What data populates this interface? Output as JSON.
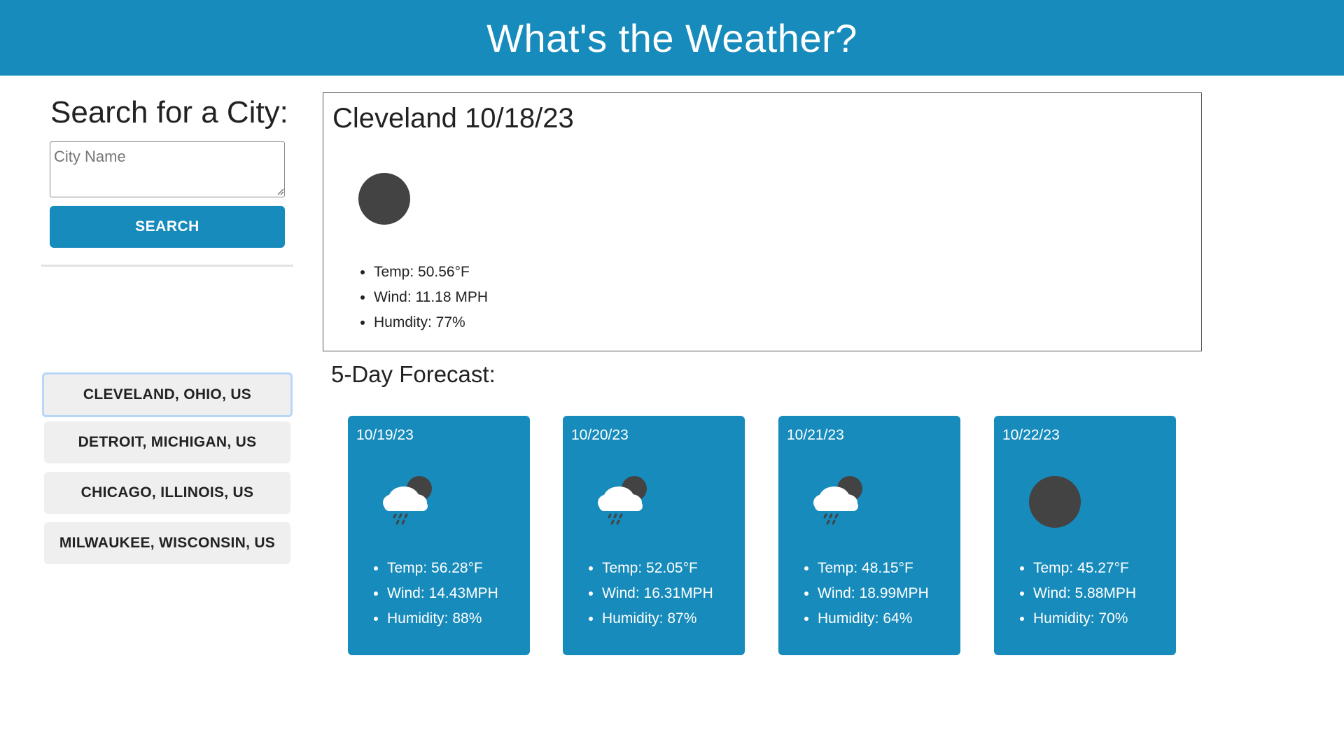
{
  "header": {
    "title": "What's the Weather?"
  },
  "sidebar": {
    "search_title": "Search for a City:",
    "input_placeholder": "City Name",
    "search_button": "SEARCH",
    "history": [
      {
        "label": "CLEVELAND, OHIO, US"
      },
      {
        "label": "DETROIT, MICHIGAN, US"
      },
      {
        "label": "CHICAGO, ILLINOIS, US"
      },
      {
        "label": "MILWAUKEE, WISCONSIN, US"
      }
    ]
  },
  "current": {
    "title": "Cleveland 10/18/23",
    "icon": "dark-circle-icon",
    "temp": "Temp: 50.56°F",
    "wind": "Wind: 11.18 MPH",
    "humidity": "Humdity: 77%"
  },
  "forecast": {
    "title": "5-Day Forecast:",
    "days": [
      {
        "date": "10/19/23",
        "icon": "rain-cloud-icon",
        "temp": "Temp: 56.28°F",
        "wind": "Wind: 14.43MPH",
        "humidity": "Humidity: 88%"
      },
      {
        "date": "10/20/23",
        "icon": "rain-cloud-icon",
        "temp": "Temp: 52.05°F",
        "wind": "Wind: 16.31MPH",
        "humidity": "Humidity: 87%"
      },
      {
        "date": "10/21/23",
        "icon": "rain-cloud-icon",
        "temp": "Temp: 48.15°F",
        "wind": "Wind: 18.99MPH",
        "humidity": "Humidity: 64%"
      },
      {
        "date": "10/22/23",
        "icon": "dark-circle-icon",
        "temp": "Temp: 45.27°F",
        "wind": "Wind: 5.88MPH",
        "humidity": "Humidity: 70%"
      }
    ]
  },
  "colors": {
    "primary": "#178bbb",
    "history_bg": "#efefef",
    "icon_dark": "#434343"
  }
}
